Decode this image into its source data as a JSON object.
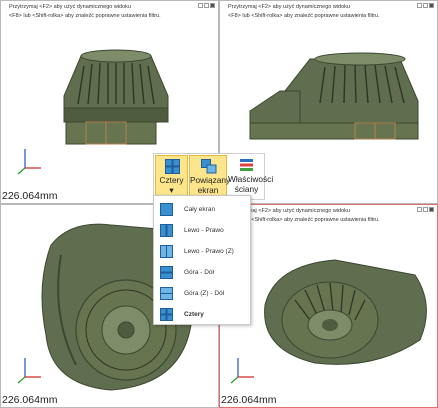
{
  "viewports": [
    {
      "hint_line1": "Przytrzymaj <F2> aby użyć dynamicznego widoku",
      "hint_line2": "<F8> lub <Shift-rolka> aby znaleźć poprawne ustawienia filtru.",
      "scale": "226.064mm"
    },
    {
      "hint_line1": "Przytrzymaj <F2> aby użyć dynamicznego widoku",
      "hint_line2": "<F8> lub <Shift-rolka> aby znaleźć poprawne ustawienia filtru.",
      "scale": ""
    },
    {
      "hint_line1": "",
      "hint_line2": "",
      "scale": "226.064mm"
    },
    {
      "hint_line1": "Przytrzymaj <F2> aby użyć dynamicznego widoku",
      "hint_line2": "<F8> lub <Shift-rolka> aby znaleźć poprawne ustawienia filtru.",
      "scale": "226.064mm"
    }
  ],
  "ribbon": {
    "btn_cztery": "Cztery",
    "btn_cztery_arrow": "▾",
    "btn_powiazany_1": "Powiązany",
    "btn_powiazany_2": "ekran",
    "btn_wlasciwosci_1": "Właściwości",
    "btn_wlasciwosci_2": "ściany"
  },
  "menu": {
    "items": [
      {
        "label": "Cały ekran",
        "icon": "layout-full-icon"
      },
      {
        "label": "Lewo - Prawo",
        "icon": "layout-left-right-icon"
      },
      {
        "label": "Lewo - Prawo (Z)",
        "icon": "layout-left-right-z-icon"
      },
      {
        "label": "Góra - Dół",
        "icon": "layout-top-bottom-icon"
      },
      {
        "label": "Góra (Z) - Dół",
        "icon": "layout-top-z-bottom-icon"
      },
      {
        "label": "Cztery",
        "icon": "layout-four-icon"
      }
    ]
  },
  "colors": {
    "model": "#5f6e4e",
    "model_dark": "#3d4731",
    "model_light": "#7d8c69",
    "accent_orange": "#c8864a",
    "active_border": "#e07070",
    "menu_icon": "#3a8fd0"
  }
}
